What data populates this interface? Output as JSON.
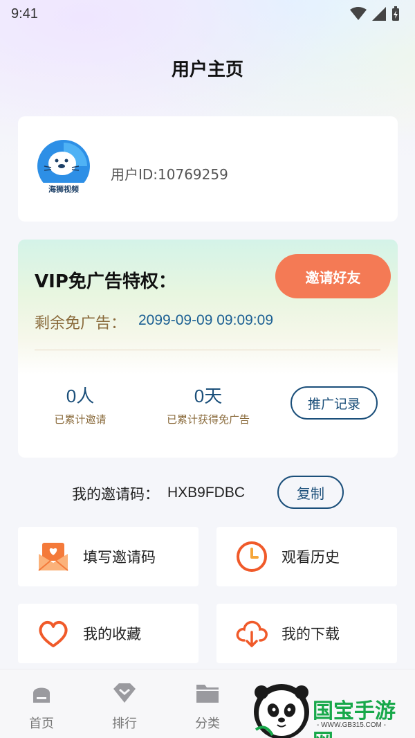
{
  "status_bar": {
    "time": "9:41"
  },
  "header": {
    "title": "用户主页"
  },
  "profile": {
    "avatar_caption": "海狮视频",
    "user_id": "用户ID:10769259"
  },
  "vip": {
    "title": "VIP免广告特权：",
    "invite_button": "邀请好友",
    "remain_label": "剩余免广告：",
    "remain_value": "2099-09-09 09:09:09",
    "stats": [
      {
        "value": "0人",
        "label": "已累计邀请"
      },
      {
        "value": "0天",
        "label": "已累计获得免广告"
      }
    ],
    "record_button": "推广记录"
  },
  "invite_code": {
    "label": "我的邀请码：",
    "value": "HXB9FDBC",
    "copy_button": "复制"
  },
  "menu": [
    {
      "label": "填写邀请码",
      "icon": "envelope-heart-icon"
    },
    {
      "label": "观看历史",
      "icon": "clock-icon"
    },
    {
      "label": "我的收藏",
      "icon": "heart-icon"
    },
    {
      "label": "我的下载",
      "icon": "cloud-download-icon"
    }
  ],
  "tabbar": [
    {
      "label": "首页",
      "icon": "home-icon"
    },
    {
      "label": "排行",
      "icon": "diamond-icon"
    },
    {
      "label": "分类",
      "icon": "folder-icon"
    }
  ],
  "watermark": {
    "text": "国宝手游网",
    "url": "- WWW.GB315.COM -"
  },
  "colors": {
    "accent_orange": "#f47a55",
    "accent_blue": "#1b4f7a",
    "gold_text": "#8a6b3c",
    "watermark_green": "#18a84a"
  }
}
